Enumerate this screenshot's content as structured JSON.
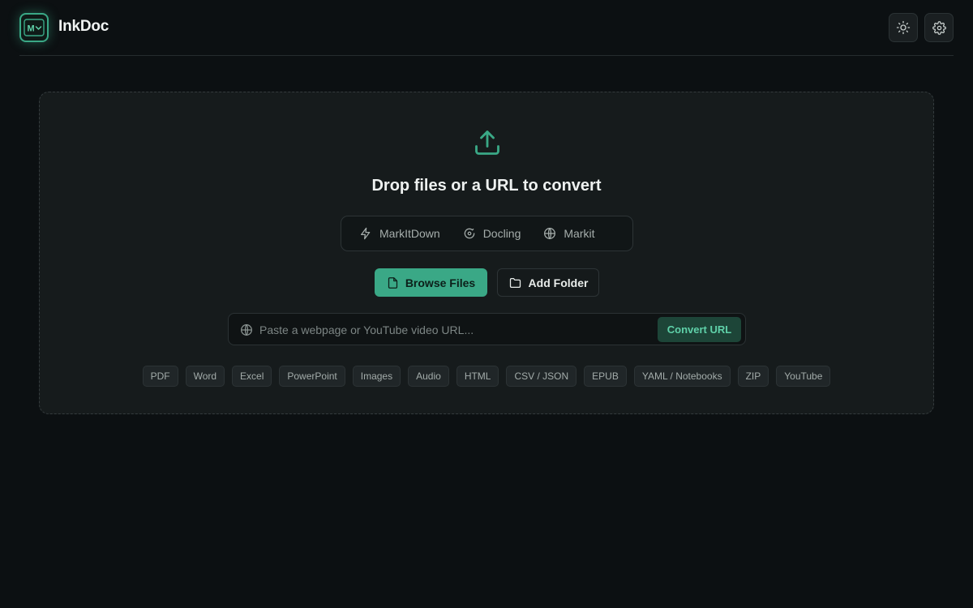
{
  "app": {
    "title": "InkDoc",
    "logo_text": "M"
  },
  "header": {
    "theme_toggle_icon": "sun-icon",
    "settings_icon": "gear-icon"
  },
  "dropzone": {
    "icon": "upload-icon",
    "title": "Drop files or a URL to convert",
    "engines": [
      {
        "label": "MarkItDown",
        "icon": "lightning-icon"
      },
      {
        "label": "Docling",
        "icon": "docling-icon"
      },
      {
        "label": "Markit",
        "icon": "globe-icon"
      }
    ],
    "browse_label": "Browse Files",
    "folder_label": "Add Folder",
    "url_placeholder": "Paste a webpage or YouTube video URL...",
    "convert_label": "Convert URL",
    "formats": [
      "PDF",
      "Word",
      "Excel",
      "PowerPoint",
      "Images",
      "Audio",
      "HTML",
      "CSV / JSON",
      "EPUB",
      "YAML / Notebooks",
      "ZIP",
      "YouTube"
    ]
  },
  "colors": {
    "background": "#0c1012",
    "accent": "#3aa886",
    "panel": "#161b1c"
  }
}
